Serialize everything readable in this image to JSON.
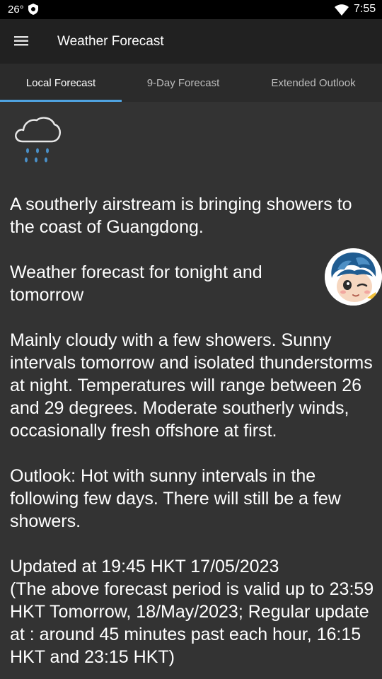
{
  "status_bar": {
    "temperature": "26°",
    "time": "7:55"
  },
  "app_bar": {
    "title": "Weather Forecast",
    "menu_icon": "hamburger-menu-icon"
  },
  "tabs": [
    {
      "label": "Local Forecast",
      "active": true
    },
    {
      "label": "9-Day Forecast",
      "active": false
    },
    {
      "label": "Extended Outlook",
      "active": false
    }
  ],
  "weather_icon": "cloud-with-rain-icon",
  "forecast": {
    "general_situation": "A southerly airstream is bringing showers to the coast of Guangdong.",
    "period_heading": "Weather forecast for tonight and tomorrow",
    "description": "Mainly cloudy with a few showers. Sunny intervals tomorrow and isolated thunderstorms at night. Temperatures will range between 26 and 29 degrees. Moderate southerly winds, occasionally fresh offshore at first.",
    "outlook": "Outlook: Hot with sunny intervals in the following few days. There will still be a few showers.",
    "updated_line": "Updated at 19:45 HKT 17/05/2023",
    "validity_line": "(The above forecast period is valid up to 23:59 HKT Tomorrow, 18/May/2023; Regular update at : around 45 minutes past each hour, 16:15 HKT and 23:15 HKT)"
  },
  "colors": {
    "background": "#333333",
    "app_bar": "#212121",
    "tab_indicator": "#4fa3e0"
  }
}
